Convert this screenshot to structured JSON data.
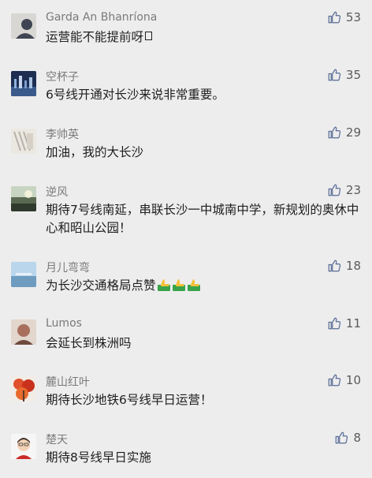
{
  "comments": [
    {
      "name": "Garda An Bhanríona",
      "text": "运营能不能提前呀",
      "likes": "53",
      "avatar_color": "#3f4552"
    },
    {
      "name": "空杯子",
      "text": "6号线开通对长沙来说非常重要。",
      "likes": "35",
      "avatar_color": "#243a66"
    },
    {
      "name": "李帅英",
      "text": "加油，我的大长沙",
      "likes": "29",
      "avatar_color": "#cfcac2"
    },
    {
      "name": "逆风",
      "text": "期待7号线南延，串联长沙一中城南中学，新规划的奥休中心和昭山公园！",
      "likes": "23",
      "avatar_color": "#6b7a64"
    },
    {
      "name": "月儿弯弯",
      "text": "为长沙交通格局点赞",
      "likes": "18",
      "avatar_color": "#9ec4e0"
    },
    {
      "name": "Lumos",
      "text": "会延长到株洲吗",
      "likes": "11",
      "avatar_color": "#b89080"
    },
    {
      "name": "麓山红叶",
      "text": "期待长沙地铁6号线早日运营！",
      "likes": "10",
      "avatar_color": "#d64a28"
    },
    {
      "name": "楚天",
      "text": "期待8号线早日实施",
      "likes": "8",
      "avatar_color": "#f4f4f4"
    }
  ],
  "icons": {
    "like": "thumbs-up-icon",
    "emoji": "thumbs-up-emoji"
  },
  "colors": {
    "like_icon": "#576b95",
    "background": "#ededed"
  }
}
